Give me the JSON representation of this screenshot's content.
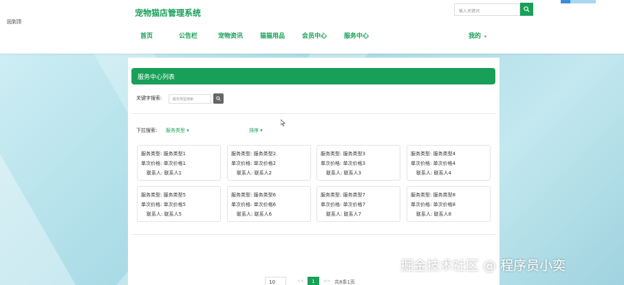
{
  "header": {
    "corner_text": "回到顶",
    "site_title": "宠物猫店管理系统",
    "search_placeholder": "输入关键词",
    "nav": [
      "首页",
      "公告栏",
      "宠物资讯",
      "猫猫用品",
      "会员中心",
      "服务中心"
    ],
    "me_label": "我的"
  },
  "panel": {
    "title": "服务中心列表",
    "keyword_label": "关键字搜索:",
    "keyword_placeholder": "服务类型搜索",
    "dropdown_label": "下拉搜索:",
    "dropdown_type": "服务类型",
    "dropdown_sort": "排序"
  },
  "cards": [
    {
      "type": "服务类型: 服务类型1",
      "price": "单次价格: 单次价格1",
      "contact": "联系人: 联系人1"
    },
    {
      "type": "服务类型: 服务类型2",
      "price": "单次价格: 单次价格2",
      "contact": "联系人: 联系人2"
    },
    {
      "type": "服务类型: 服务类型3",
      "price": "单次价格: 单次价格3",
      "contact": "联系人: 联系人3"
    },
    {
      "type": "服务类型: 服务类型4",
      "price": "单次价格: 单次价格4",
      "contact": "联系人: 联系人4"
    },
    {
      "type": "服务类型: 服务类型5",
      "price": "单次价格: 单次价格5",
      "contact": "联系人: 联系人5"
    },
    {
      "type": "服务类型: 服务类型6",
      "price": "单次价格: 单次价格6",
      "contact": "联系人: 联系人6"
    },
    {
      "type": "服务类型: 服务类型7",
      "price": "单次价格: 单次价格7",
      "contact": "联系人: 联系人7"
    },
    {
      "type": "服务类型: 服务类型8",
      "price": "单次价格: 单次价格8",
      "contact": "联系人: 联系人8"
    }
  ],
  "pager": {
    "page_size": "10",
    "prev": "<<",
    "current": "1",
    "next": ">>",
    "total": "共8条1页"
  },
  "watermark": "掘金技术社区 @ 程序员小奕",
  "colors": {
    "accent": "#18a058"
  }
}
